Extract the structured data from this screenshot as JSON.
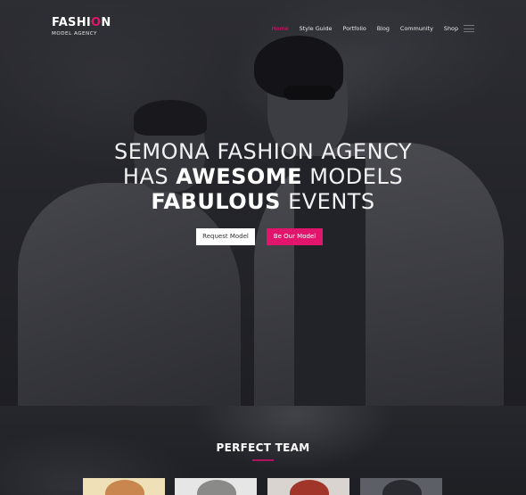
{
  "brand": {
    "name_pre": "FASHI",
    "name_o": "O",
    "name_post": "N",
    "tagline": "MODEL AGENCY",
    "accent_color": "#e2156d"
  },
  "nav": {
    "items": [
      {
        "label": "Home",
        "active": true
      },
      {
        "label": "Style Guide",
        "active": false
      },
      {
        "label": "Portfolio",
        "active": false
      },
      {
        "label": "Blog",
        "active": false
      },
      {
        "label": "Community",
        "active": false
      },
      {
        "label": "Shop",
        "active": false
      }
    ],
    "menu_icon": "hamburger-icon"
  },
  "hero": {
    "line1": "SEMONA FASHION AGENCY",
    "line2_pre": "HAS ",
    "line2_bold": "AWESOME",
    "line2_post": " MODELS",
    "line3_bold": "FABULOUS",
    "line3_post": " EVENTS",
    "buttons": {
      "request": "Request Model",
      "be_model": "Be Our Model"
    }
  },
  "team": {
    "title": "PERFECT TEAM"
  }
}
